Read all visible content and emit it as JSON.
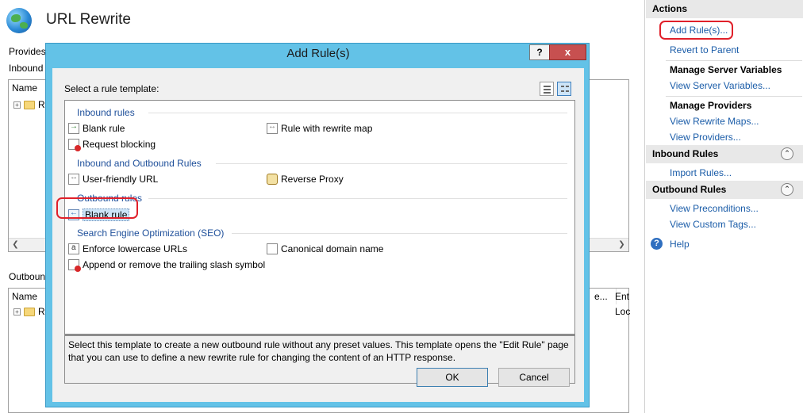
{
  "main": {
    "title": "URL Rewrite",
    "providers_label": "Provides",
    "inbound_label": "Inbound",
    "outbound_label": "Outbound",
    "inbound_table": {
      "columns": [
        "Name"
      ],
      "rows": [
        {
          "label": "R"
        }
      ]
    },
    "outbound_table": {
      "columns": [
        "Name",
        "e...",
        "Ent"
      ],
      "rows": [
        {
          "label": "R",
          "entry": "Loc"
        }
      ]
    }
  },
  "actions": {
    "header": "Actions",
    "add_rules": "Add Rule(s)...",
    "revert": "Revert to Parent",
    "manage_server_vars": "Manage Server Variables",
    "view_server_vars": "View Server Variables...",
    "manage_providers": "Manage Providers",
    "view_rewrite_maps": "View Rewrite Maps...",
    "view_providers": "View Providers...",
    "inbound_rules": "Inbound Rules",
    "import_rules": "Import Rules...",
    "outbound_rules": "Outbound Rules",
    "view_preconditions": "View Preconditions...",
    "view_custom_tags": "View Custom Tags...",
    "help": "Help"
  },
  "dialog": {
    "title": "Add Rule(s)",
    "help_btn": "?",
    "close_btn": "x",
    "select_label": "Select a rule template:",
    "groups": {
      "inbound": "Inbound rules",
      "inbound_outbound": "Inbound and Outbound Rules",
      "outbound": "Outbound rules",
      "seo": "Search Engine Optimization (SEO)"
    },
    "items": {
      "blank_rule": "Blank rule",
      "rule_with_map": "Rule with rewrite map",
      "request_blocking": "Request blocking",
      "user_friendly": "User-friendly URL",
      "reverse_proxy": "Reverse Proxy",
      "outbound_blank": "Blank rule",
      "lowercase": "Enforce lowercase URLs",
      "canonical": "Canonical domain name",
      "trailing_slash": "Append or remove the trailing slash symbol"
    },
    "description": "Select this template to create a new outbound rule without any preset values. This template opens the \"Edit Rule\" page that you can use to define a new rewrite rule for changing the content of an HTTP response.",
    "ok": "OK",
    "cancel": "Cancel"
  },
  "colors": {
    "dialog_frame": "#63c2e7",
    "link": "#1a5ca8",
    "group_head": "#1e4f9a",
    "annotation": "#e0202a"
  }
}
